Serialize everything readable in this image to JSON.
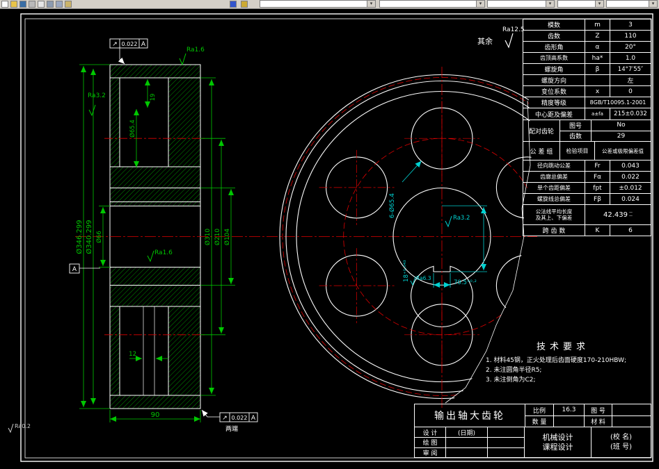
{
  "toolbar": {
    "icons": [
      "new-icon",
      "open-icon",
      "save-icon",
      "print-icon",
      "preview-icon",
      "cut-icon",
      "copy-icon",
      "paste-icon",
      "undo-icon",
      "redo-icon"
    ],
    "combos": [
      "layer-combo",
      "color-combo",
      "linetype-combo",
      "lineweight-combo",
      "plotstyle-combo"
    ]
  },
  "colors": {
    "dim_green": "#00c800",
    "dim_cyan": "#00d2d2",
    "centerline_red": "#e00000",
    "line_white": "#ffffff",
    "toolbar_gray": "#d4d0c8"
  },
  "param_table": {
    "simple_rows": [
      {
        "label": "模数",
        "sym": "m",
        "val": "3"
      },
      {
        "label": "齿数",
        "sym": "Z",
        "val": "110"
      },
      {
        "label": "齿形角",
        "sym": "α",
        "val": "20°"
      },
      {
        "label": "齿顶高系数",
        "sym": "ha*",
        "val": "1.0"
      },
      {
        "label": "螺旋角",
        "sym": "β",
        "val": "14°7′55″"
      },
      {
        "label": "螺旋方向",
        "sym": "",
        "val": "左"
      },
      {
        "label": "变位系数",
        "sym": "x",
        "val": "0"
      }
    ],
    "accuracy": {
      "label": "精度等级",
      "val": "8GB/T10095.1-2001"
    },
    "center": {
      "label": "中心距及偏差",
      "sym": "a±fa",
      "val": "215±0.032"
    },
    "mating": {
      "label": "配对齿轮",
      "r1l": "图号",
      "r1v": "No",
      "r2l": "齿数",
      "r2v": "29"
    },
    "tol_header": {
      "c1": "公 差 组",
      "c2": "检验项目",
      "c3": "公差或极限偏差值"
    },
    "tol_rows": [
      {
        "label": "径向跳动公差",
        "sym": "Fr",
        "val": "0.043"
      },
      {
        "label": "齿廓总偏差",
        "sym": "Fα",
        "val": "0.022"
      },
      {
        "label": "单个齿距偏差",
        "sym": "fpt",
        "val": "±0.012"
      },
      {
        "label": "螺旋线总偏差",
        "sym": "Fβ",
        "val": "0.024"
      }
    ],
    "wk": {
      "label1": "公法线平均长度",
      "label2": "及其上、下偏差",
      "val": "42.439",
      "upper": "—",
      "lower": "—"
    },
    "span": {
      "label": "跨 齿 数",
      "sym": "K",
      "val": "6"
    }
  },
  "tech_req": {
    "title": "技术要求",
    "lines": [
      "1. 材料45钢，正火处理后齿面硬度170-210HBW;",
      "2. 未注圆角半径R5;",
      "3. 未注倒角为C2;"
    ]
  },
  "title_block": {
    "part_name": "输出轴大齿轮",
    "scale_label": "比例",
    "scale_val": "16.3",
    "dwg_label": "图 号",
    "qty_label": "数 量",
    "material_label": "材 料",
    "design_label": "设 计",
    "draw_label": "绘 图",
    "review_label": "审 阅",
    "date": "(日期)",
    "course1": "机械设计",
    "course2": "课程设计",
    "school": "(校 名)",
    "class": "(班 号)"
  },
  "ann": {
    "fcf_sym": "↗",
    "fcf_tol": "0.022",
    "fcf_datum": "A",
    "fcf_note": "两端",
    "datum_a": "A",
    "ra_top": "Ra1.6",
    "ra_left": "Ra3.2",
    "ra_bore": "Ra1.6",
    "ra_corner": "Ra0.2",
    "rest_label": "其余",
    "rest_value": "Ra12.5",
    "dia_tip": "Ø346.299",
    "dia_pitch": "Ø340.299",
    "dia_bore": "Ø66",
    "dia_rim": "Ø310",
    "dia_pc": "Ø210",
    "dia_hub": "Ø104",
    "hole_dia": "Ø65.4",
    "hole_side": "19",
    "web": "12",
    "face_width": "90",
    "hole_callout": "6-Ø65.4",
    "ra_bore_front": "Ra3.2",
    "ra_key": "Ra6.3",
    "key_width": "18⁺⁰·⁰⁴³",
    "key_depth": "70.5⁺⁰·²"
  }
}
